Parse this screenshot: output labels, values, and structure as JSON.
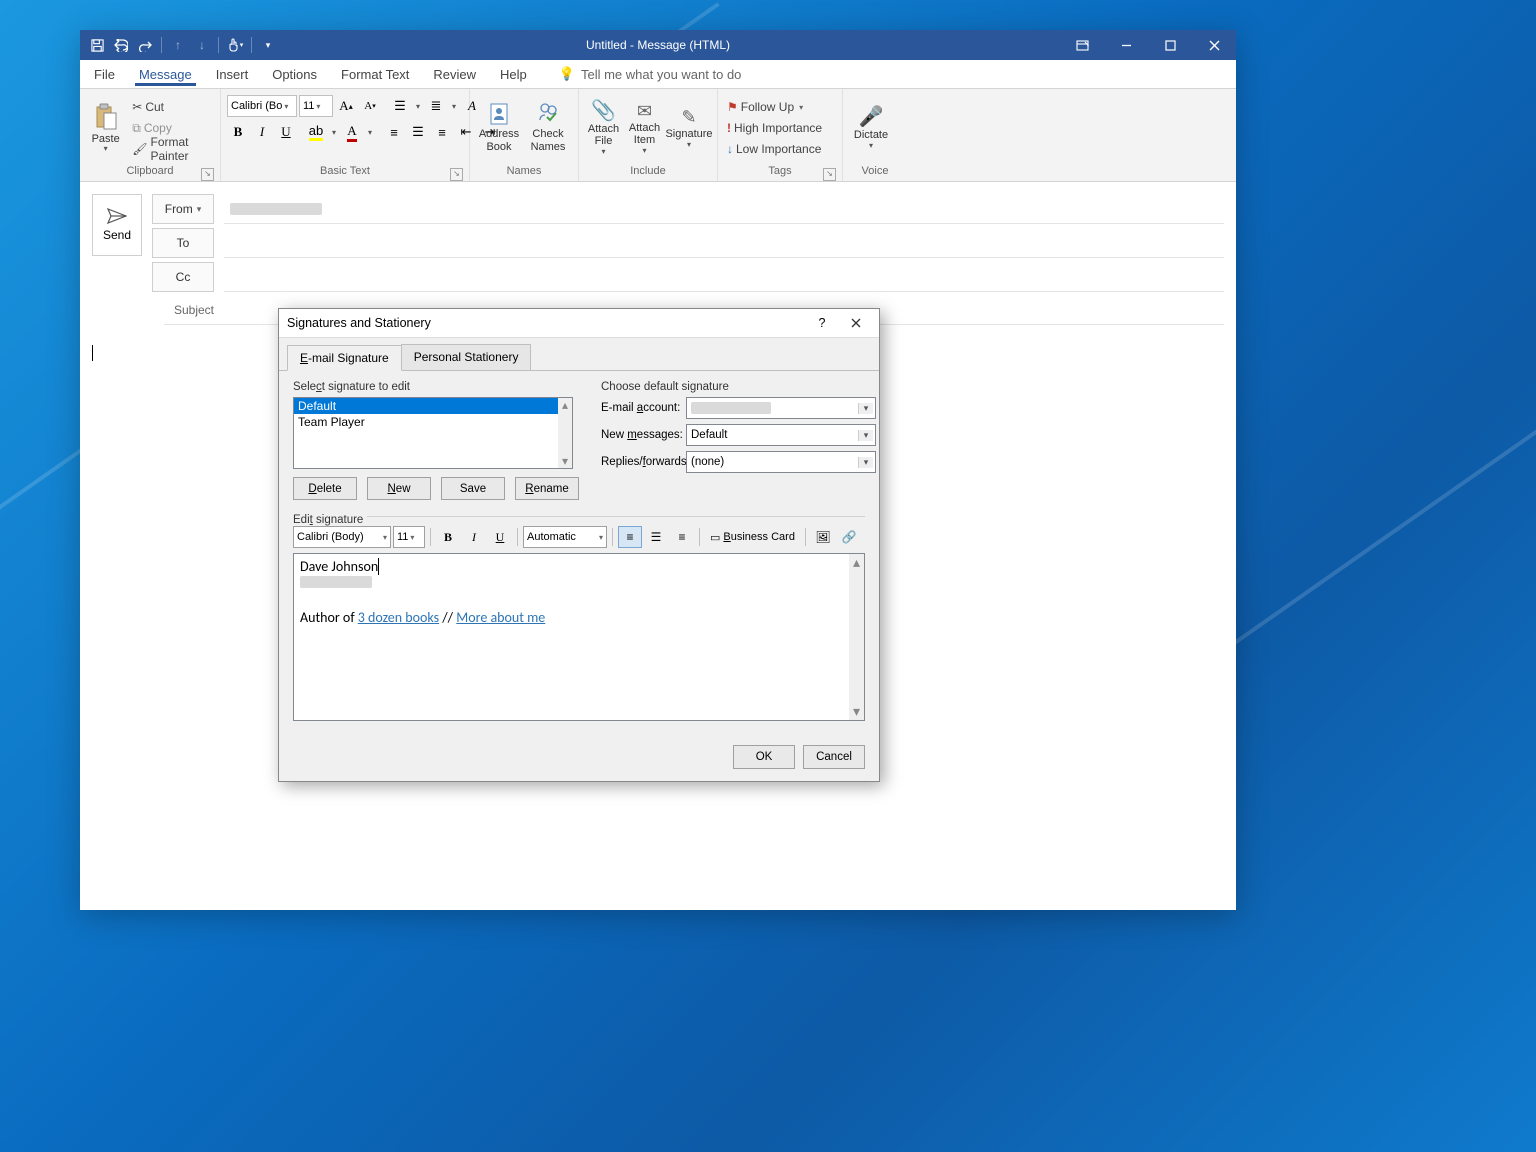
{
  "window": {
    "title": "Untitled  -  Message (HTML)"
  },
  "ribbon_tabs": {
    "file": "File",
    "message": "Message",
    "insert": "Insert",
    "options": "Options",
    "format_text": "Format Text",
    "review": "Review",
    "help": "Help",
    "tell_me": "Tell me what you want to do"
  },
  "ribbon": {
    "clipboard": {
      "label": "Clipboard",
      "paste": "Paste",
      "cut": "Cut",
      "copy": "Copy",
      "format_painter": "Format Painter"
    },
    "basic_text": {
      "label": "Basic Text",
      "font_name": "Calibri (Bo",
      "font_size": "11"
    },
    "names": {
      "label": "Names",
      "address_book": "Address Book",
      "check_names": "Check Names"
    },
    "include": {
      "label": "Include",
      "attach_file": "Attach File",
      "attach_item": "Attach Item",
      "signature": "Signature"
    },
    "tags": {
      "label": "Tags",
      "follow_up": "Follow Up",
      "high": "High Importance",
      "low": "Low Importance"
    },
    "voice": {
      "label": "Voice",
      "dictate": "Dictate"
    }
  },
  "compose": {
    "send": "Send",
    "from": "From",
    "to": "To",
    "cc": "Cc",
    "subject": "Subject"
  },
  "dialog": {
    "title": "Signatures and Stationery",
    "tabs": {
      "email_sig": "E-mail Signature",
      "personal": "Personal Stationery"
    },
    "select_sig_label": "Select signature to edit",
    "sig_list": {
      "default": "Default",
      "team_player": "Team Player"
    },
    "buttons": {
      "delete": "Delete",
      "new": "New",
      "save": "Save",
      "rename": "Rename"
    },
    "choose_default": "Choose default signature",
    "email_account_lbl": "E-mail account:",
    "new_messages_lbl": "New messages:",
    "new_messages_val": "Default",
    "replies_lbl": "Replies/forwards:",
    "replies_val": "(none)",
    "edit_sig": "Edit signature",
    "toolbar": {
      "font": "Calibri (Body)",
      "size": "11",
      "color": "Automatic",
      "business_card": "Business Card"
    },
    "sig_content": {
      "name": "Dave Johnson",
      "author_prefix": "Author of ",
      "link1": "3 dozen books",
      "sep": " // ",
      "link2": "More about me"
    },
    "ok": "OK",
    "cancel": "Cancel"
  }
}
